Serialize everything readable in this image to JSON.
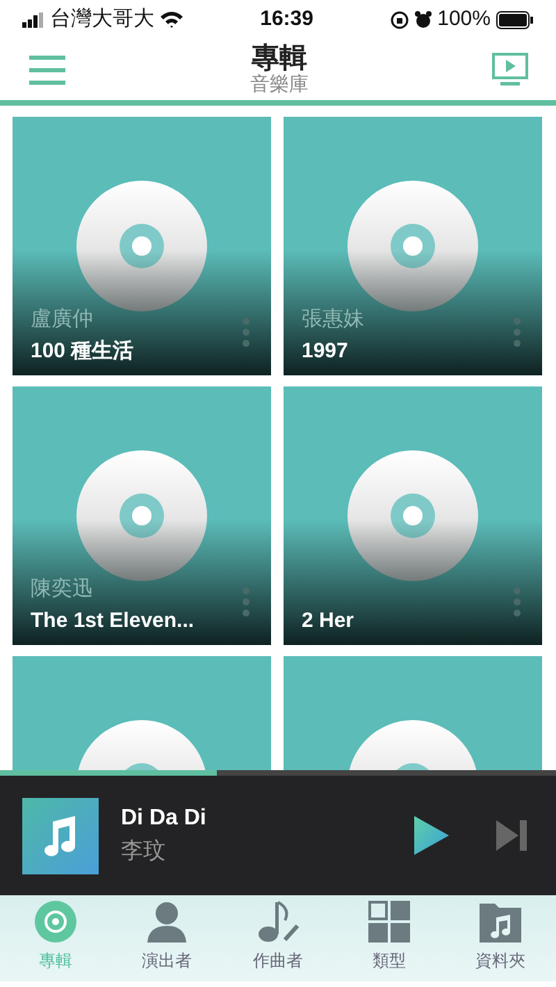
{
  "status_bar": {
    "carrier": "台灣大哥大",
    "time": "16:39",
    "battery": "100%"
  },
  "header": {
    "title": "專輯",
    "subtitle": "音樂庫"
  },
  "albums": [
    {
      "kind": "full",
      "artist": "盧廣仲",
      "title": "100 種生活"
    },
    {
      "kind": "full",
      "artist": "張惠妹",
      "title": "1997"
    },
    {
      "kind": "full",
      "artist": "陳奕迅",
      "title": "The 1st Eleven..."
    },
    {
      "kind": "full",
      "title": "2 Her"
    },
    {
      "kind": "cover-only"
    },
    {
      "kind": "cover-only"
    }
  ],
  "now_playing": {
    "title": "Di Da Di",
    "artist": "李玟",
    "level": 0.39
  },
  "tabs": [
    {
      "kind": "disc",
      "label": "專輯",
      "selected": true
    },
    {
      "kind": "person",
      "label": "演出者",
      "selected": false
    },
    {
      "kind": "note",
      "label": "作曲者",
      "selected": false
    },
    {
      "kind": "grid",
      "label": "類型",
      "selected": false
    },
    {
      "kind": "folder",
      "label": "資料夾",
      "selected": false
    }
  ]
}
